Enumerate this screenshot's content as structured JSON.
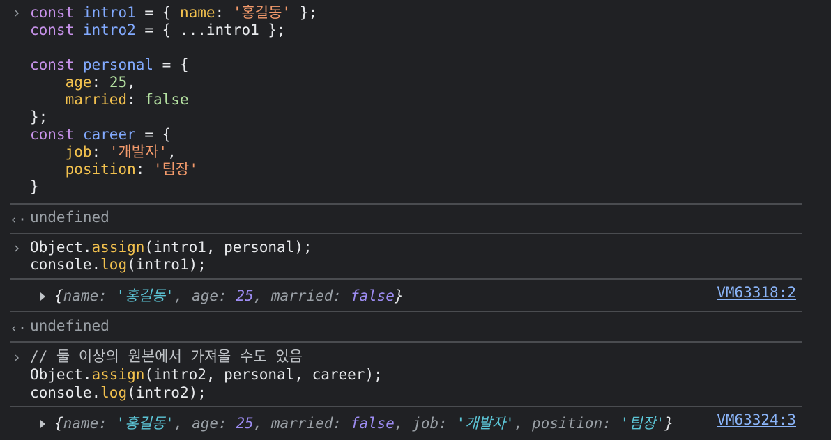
{
  "colors": {
    "background": "#202124",
    "separator": "#4a4c50",
    "link": "#8ab4f8"
  },
  "blocks": {
    "input1": {
      "prompt_icon": "chevron-right-icon",
      "lines": [
        [
          {
            "t": "const",
            "c": "kw"
          },
          {
            "t": " ",
            "c": "plain"
          },
          {
            "t": "intro1",
            "c": "def"
          },
          {
            "t": " = { ",
            "c": "plain"
          },
          {
            "t": "name",
            "c": "prop"
          },
          {
            "t": ": ",
            "c": "plain"
          },
          {
            "t": "'홍길동'",
            "c": "str"
          },
          {
            "t": " };",
            "c": "plain"
          }
        ],
        [
          {
            "t": "const",
            "c": "kw"
          },
          {
            "t": " ",
            "c": "plain"
          },
          {
            "t": "intro2",
            "c": "def"
          },
          {
            "t": " = { ...intro1 };",
            "c": "plain"
          }
        ],
        [],
        [
          {
            "t": "const",
            "c": "kw"
          },
          {
            "t": " ",
            "c": "plain"
          },
          {
            "t": "personal",
            "c": "def"
          },
          {
            "t": " = {",
            "c": "plain"
          }
        ],
        [
          {
            "t": "    ",
            "c": "plain"
          },
          {
            "t": "age",
            "c": "prop"
          },
          {
            "t": ": ",
            "c": "plain"
          },
          {
            "t": "25",
            "c": "num"
          },
          {
            "t": ",",
            "c": "plain"
          }
        ],
        [
          {
            "t": "    ",
            "c": "plain"
          },
          {
            "t": "married",
            "c": "prop"
          },
          {
            "t": ": ",
            "c": "plain"
          },
          {
            "t": "false",
            "c": "bool"
          }
        ],
        [
          {
            "t": "};",
            "c": "plain"
          }
        ],
        [
          {
            "t": "const",
            "c": "kw"
          },
          {
            "t": " ",
            "c": "plain"
          },
          {
            "t": "career",
            "c": "def"
          },
          {
            "t": " = {",
            "c": "plain"
          }
        ],
        [
          {
            "t": "    ",
            "c": "plain"
          },
          {
            "t": "job",
            "c": "prop"
          },
          {
            "t": ": ",
            "c": "plain"
          },
          {
            "t": "'개발자'",
            "c": "str"
          },
          {
            "t": ",",
            "c": "plain"
          }
        ],
        [
          {
            "t": "    ",
            "c": "plain"
          },
          {
            "t": "position",
            "c": "prop"
          },
          {
            "t": ": ",
            "c": "plain"
          },
          {
            "t": "'팀장'",
            "c": "str"
          }
        ],
        [
          {
            "t": "}",
            "c": "plain"
          }
        ]
      ]
    },
    "result1": {
      "prompt_icon": "return-arrow-icon",
      "text": "undefined"
    },
    "input2": {
      "lines": [
        [
          {
            "t": "Object.",
            "c": "plain"
          },
          {
            "t": "assign",
            "c": "fn"
          },
          {
            "t": "(intro1, personal);",
            "c": "plain"
          }
        ],
        [
          {
            "t": "console.",
            "c": "plain"
          },
          {
            "t": "log",
            "c": "fn"
          },
          {
            "t": "(intro1);",
            "c": "plain"
          }
        ]
      ]
    },
    "log1": {
      "expand_icon": "expand-triangle-icon",
      "parts": [
        {
          "t": "{",
          "c": "obrace"
        },
        {
          "t": "name",
          "c": "okey"
        },
        {
          "t": ": ",
          "c": "okey"
        },
        {
          "t": "'홍길동'",
          "c": "ostr"
        },
        {
          "t": ", ",
          "c": "okey"
        },
        {
          "t": "age",
          "c": "okey"
        },
        {
          "t": ": ",
          "c": "okey"
        },
        {
          "t": "25",
          "c": "onum"
        },
        {
          "t": ", ",
          "c": "okey"
        },
        {
          "t": "married",
          "c": "okey"
        },
        {
          "t": ": ",
          "c": "okey"
        },
        {
          "t": "false",
          "c": "obool"
        },
        {
          "t": "}",
          "c": "obrace"
        }
      ],
      "source": "VM63318:2"
    },
    "result2": {
      "text": "undefined"
    },
    "input3": {
      "lines": [
        [
          {
            "t": "// 둘 이상의 원본에서 가져올 수도 있음",
            "c": "comment"
          }
        ],
        [
          {
            "t": "Object.",
            "c": "plain"
          },
          {
            "t": "assign",
            "c": "fn"
          },
          {
            "t": "(intro2, personal, career);",
            "c": "plain"
          }
        ],
        [
          {
            "t": "console.",
            "c": "plain"
          },
          {
            "t": "log",
            "c": "fn"
          },
          {
            "t": "(intro2);",
            "c": "plain"
          }
        ]
      ]
    },
    "log2": {
      "parts": [
        {
          "t": "{",
          "c": "obrace"
        },
        {
          "t": "name",
          "c": "okey"
        },
        {
          "t": ": ",
          "c": "okey"
        },
        {
          "t": "'홍길동'",
          "c": "ostr"
        },
        {
          "t": ", ",
          "c": "okey"
        },
        {
          "t": "age",
          "c": "okey"
        },
        {
          "t": ": ",
          "c": "okey"
        },
        {
          "t": "25",
          "c": "onum"
        },
        {
          "t": ", ",
          "c": "okey"
        },
        {
          "t": "married",
          "c": "okey"
        },
        {
          "t": ": ",
          "c": "okey"
        },
        {
          "t": "false",
          "c": "obool"
        },
        {
          "t": ", ",
          "c": "okey"
        },
        {
          "t": "job",
          "c": "okey"
        },
        {
          "t": ": ",
          "c": "okey"
        },
        {
          "t": "'개발자'",
          "c": "ostr"
        },
        {
          "t": ", ",
          "c": "okey"
        },
        {
          "t": "position",
          "c": "okey"
        },
        {
          "t": ": ",
          "c": "okey"
        },
        {
          "t": "'팀장'",
          "c": "ostr"
        },
        {
          "t": "}",
          "c": "obrace"
        }
      ],
      "source": "VM63324:3"
    }
  }
}
